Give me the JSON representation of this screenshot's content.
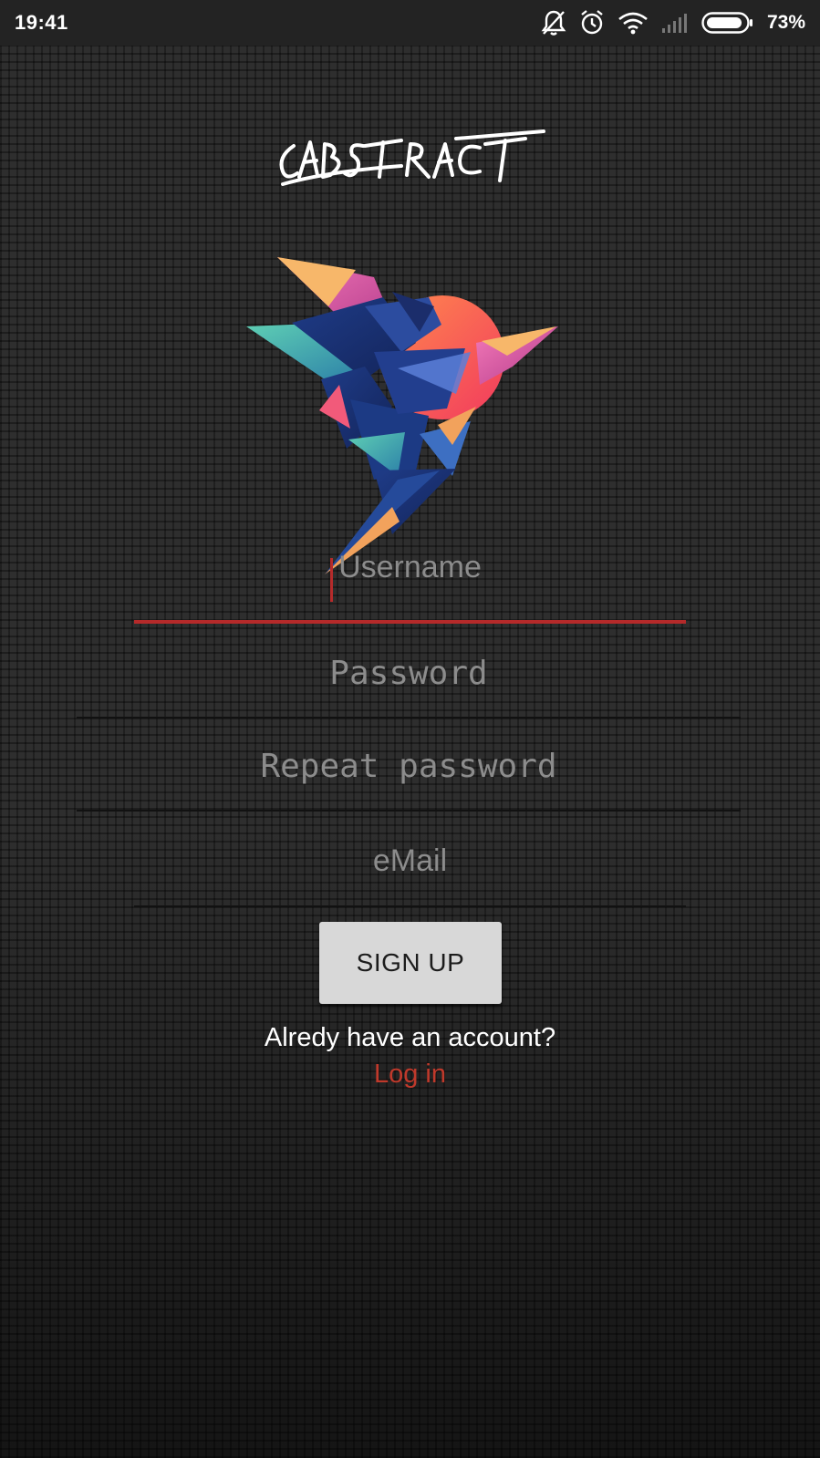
{
  "status_bar": {
    "time": "19:41",
    "battery_percent": "73%",
    "icons": [
      "bell-off-icon",
      "alarm-icon",
      "wifi-icon",
      "signal-icon",
      "battery-icon"
    ]
  },
  "brand": {
    "logo_text": "ABSTRACT"
  },
  "form": {
    "username": {
      "placeholder": "Username",
      "value": ""
    },
    "password": {
      "placeholder": "Password",
      "value": ""
    },
    "repeat_password": {
      "placeholder": "Repeat password",
      "value": ""
    },
    "email": {
      "placeholder": "eMail",
      "value": ""
    },
    "signup_label": "SIGN UP"
  },
  "footer": {
    "prompt": "Alredy have an account?",
    "login_label": "Log in"
  },
  "colors": {
    "accent": "#b52a2a",
    "button_bg": "#d8d8d8"
  }
}
